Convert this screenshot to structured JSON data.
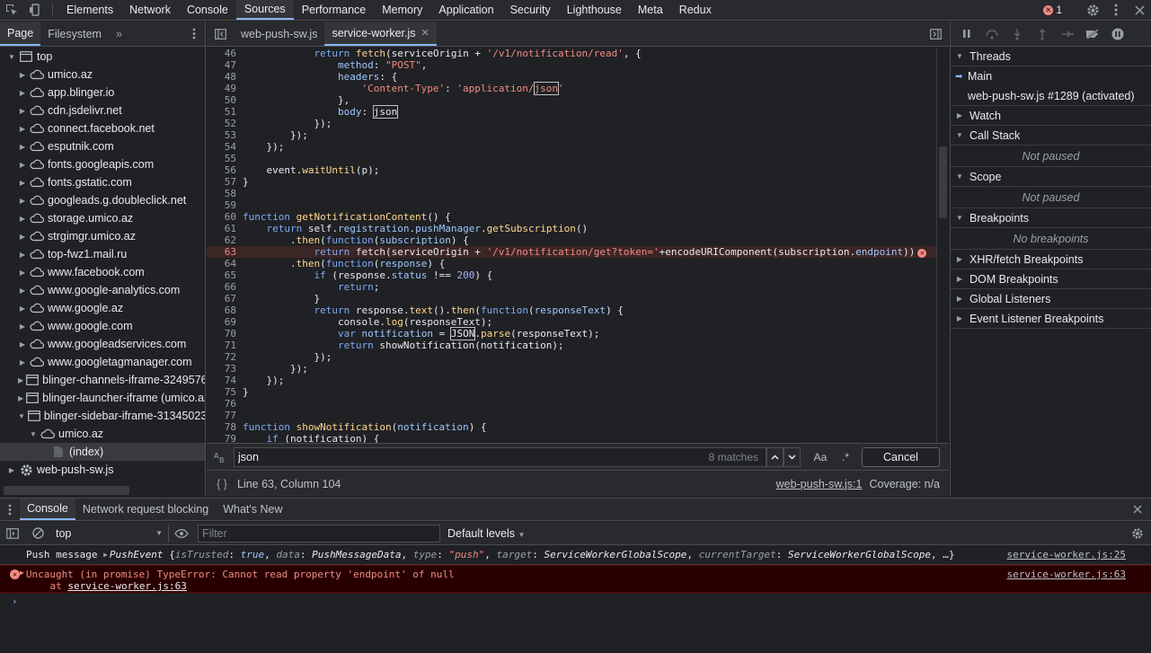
{
  "topbar": {
    "tabs": [
      "Elements",
      "Network",
      "Console",
      "Sources",
      "Performance",
      "Memory",
      "Application",
      "Security",
      "Lighthouse",
      "Meta",
      "Redux"
    ],
    "active_tab": "Sources",
    "error_count": "1"
  },
  "navigator": {
    "tabs": [
      "Page",
      "Filesystem"
    ],
    "tree": [
      {
        "label": "top",
        "icon": "frame",
        "depth": 0,
        "arrow": "down"
      },
      {
        "label": "umico.az",
        "icon": "cloud",
        "depth": 1,
        "arrow": "right"
      },
      {
        "label": "app.blinger.io",
        "icon": "cloud",
        "depth": 1,
        "arrow": "right"
      },
      {
        "label": "cdn.jsdelivr.net",
        "icon": "cloud",
        "depth": 1,
        "arrow": "right"
      },
      {
        "label": "connect.facebook.net",
        "icon": "cloud",
        "depth": 1,
        "arrow": "right"
      },
      {
        "label": "esputnik.com",
        "icon": "cloud",
        "depth": 1,
        "arrow": "right"
      },
      {
        "label": "fonts.googleapis.com",
        "icon": "cloud",
        "depth": 1,
        "arrow": "right"
      },
      {
        "label": "fonts.gstatic.com",
        "icon": "cloud",
        "depth": 1,
        "arrow": "right"
      },
      {
        "label": "googleads.g.doubleclick.net",
        "icon": "cloud",
        "depth": 1,
        "arrow": "right"
      },
      {
        "label": "storage.umico.az",
        "icon": "cloud",
        "depth": 1,
        "arrow": "right"
      },
      {
        "label": "strgimgr.umico.az",
        "icon": "cloud",
        "depth": 1,
        "arrow": "right"
      },
      {
        "label": "top-fwz1.mail.ru",
        "icon": "cloud",
        "depth": 1,
        "arrow": "right"
      },
      {
        "label": "www.facebook.com",
        "icon": "cloud",
        "depth": 1,
        "arrow": "right"
      },
      {
        "label": "www.google-analytics.com",
        "icon": "cloud",
        "depth": 1,
        "arrow": "right"
      },
      {
        "label": "www.google.az",
        "icon": "cloud",
        "depth": 1,
        "arrow": "right"
      },
      {
        "label": "www.google.com",
        "icon": "cloud",
        "depth": 1,
        "arrow": "right"
      },
      {
        "label": "www.googleadservices.com",
        "icon": "cloud",
        "depth": 1,
        "arrow": "right"
      },
      {
        "label": "www.googletagmanager.com",
        "icon": "cloud",
        "depth": 1,
        "arrow": "right"
      },
      {
        "label": "blinger-channels-iframe-3249576",
        "icon": "frame",
        "depth": 1,
        "arrow": "right"
      },
      {
        "label": "blinger-launcher-iframe (umico.az",
        "icon": "frame",
        "depth": 1,
        "arrow": "right"
      },
      {
        "label": "blinger-sidebar-iframe-31345023",
        "icon": "frame",
        "depth": 1,
        "arrow": "down"
      },
      {
        "label": "umico.az",
        "icon": "cloud",
        "depth": 2,
        "arrow": "down"
      },
      {
        "label": "(index)",
        "icon": "file",
        "depth": 3,
        "arrow": "",
        "selected": true
      },
      {
        "label": "web-push-sw.js",
        "icon": "gear",
        "depth": 0,
        "arrow": "right"
      }
    ]
  },
  "editor": {
    "tabs": [
      {
        "label": "web-push-sw.js",
        "active": false
      },
      {
        "label": "service-worker.js",
        "active": true
      }
    ],
    "lines": [
      {
        "n": "46",
        "html": "            <span class=\"kw\">return</span> <span class=\"fn\">fetch</span>(serviceOrigin + <span class=\"str\">'/v1/notification/read'</span>, {"
      },
      {
        "n": "47",
        "html": "                <span class=\"prop\">method</span>: <span class=\"str\">\"POST\"</span>,"
      },
      {
        "n": "48",
        "html": "                <span class=\"prop\">headers</span>: {"
      },
      {
        "n": "49",
        "html": "                    <span class=\"str\">'Content-Type'</span>: <span class=\"str\">'application/<span class=\"hl\">json</span>'</span>"
      },
      {
        "n": "50",
        "html": "                },"
      },
      {
        "n": "51",
        "html": "                <span class=\"prop\">body</span>: <span class=\"hl\">json</span>"
      },
      {
        "n": "52",
        "html": "            });"
      },
      {
        "n": "53",
        "html": "        });"
      },
      {
        "n": "54",
        "html": "    });"
      },
      {
        "n": "55",
        "html": ""
      },
      {
        "n": "56",
        "html": "    event.<span class=\"fn\">waitUntil</span>(p);"
      },
      {
        "n": "57",
        "html": "}"
      },
      {
        "n": "58",
        "html": ""
      },
      {
        "n": "59",
        "html": ""
      },
      {
        "n": "60",
        "html": "<span class=\"kw\">function</span> <span class=\"fn\">getNotificationContent</span>() {"
      },
      {
        "n": "61",
        "html": "    <span class=\"kw\">return</span> self.<span class=\"prop\">registration</span>.<span class=\"prop\">pushManager</span>.<span class=\"fn\">getSubscription</span>()"
      },
      {
        "n": "62",
        "html": "        .<span class=\"fn\">then</span>(<span class=\"kw\">function</span>(<span class=\"prop\">subscription</span>) {"
      },
      {
        "n": "63",
        "html": "            <span class=\"kw\">return</span> fetch(serviceOrigin + <span class=\"str\">'/v1/notification/get?token='</span>+encodeURIComponent(subscription.<span class=\"prop\">endpoint</span>))<span class=\"errmark\">✕</span>",
        "error": true
      },
      {
        "n": "64",
        "html": "        .<span class=\"fn\">then</span>(<span class=\"kw\">function</span>(<span class=\"prop\">response</span>) {"
      },
      {
        "n": "65",
        "html": "            <span class=\"kw\">if</span> (response.<span class=\"prop\">status</span> !== <span class=\"num\">200</span>) {"
      },
      {
        "n": "66",
        "html": "                <span class=\"kw\">return</span>;"
      },
      {
        "n": "67",
        "html": "            }"
      },
      {
        "n": "68",
        "html": "            <span class=\"kw\">return</span> response.<span class=\"fn\">text</span>().<span class=\"fn\">then</span>(<span class=\"kw\">function</span>(<span class=\"prop\">responseText</span>) {"
      },
      {
        "n": "69",
        "html": "                console.<span class=\"fn\">log</span>(responseText);"
      },
      {
        "n": "70",
        "html": "                <span class=\"kw\">var</span> <span class=\"prop\">notification</span> = <span class=\"hl\">JSON</span>.<span class=\"fn\">parse</span>(responseText);"
      },
      {
        "n": "71",
        "html": "                <span class=\"kw\">return</span> showNotification(notification);"
      },
      {
        "n": "72",
        "html": "            });"
      },
      {
        "n": "73",
        "html": "        });"
      },
      {
        "n": "74",
        "html": "    });"
      },
      {
        "n": "75",
        "html": "}"
      },
      {
        "n": "76",
        "html": ""
      },
      {
        "n": "77",
        "html": ""
      },
      {
        "n": "78",
        "html": "<span class=\"kw\">function</span> <span class=\"fn\">showNotification</span>(<span class=\"prop\">notification</span>) {"
      },
      {
        "n": "79",
        "html": "    <span class=\"kw\">if</span> (notification) {"
      }
    ],
    "search": {
      "value": "json",
      "count": "8 matches",
      "case_label": "Aa",
      "regex_label": ".*",
      "cancel_label": "Cancel"
    },
    "status": {
      "pretty_label": "{ }",
      "position": "Line 63, Column 104",
      "link": "web-push-sw.js:1",
      "coverage": "Coverage: n/a"
    }
  },
  "debugger": {
    "threads_label": "Threads",
    "threads": [
      {
        "label": "Main",
        "current": true
      },
      {
        "label": "web-push-sw.js #1289 (activated)",
        "current": false
      }
    ],
    "sections": [
      {
        "label": "Watch",
        "open": false,
        "empty": ""
      },
      {
        "label": "Call Stack",
        "open": true,
        "empty": "Not paused"
      },
      {
        "label": "Scope",
        "open": true,
        "empty": "Not paused"
      },
      {
        "label": "Breakpoints",
        "open": true,
        "empty": "No breakpoints"
      },
      {
        "label": "XHR/fetch Breakpoints",
        "open": false,
        "empty": ""
      },
      {
        "label": "DOM Breakpoints",
        "open": false,
        "empty": ""
      },
      {
        "label": "Global Listeners",
        "open": false,
        "empty": ""
      },
      {
        "label": "Event Listener Breakpoints",
        "open": false,
        "empty": ""
      }
    ]
  },
  "drawer": {
    "tabs": [
      "Console",
      "Network request blocking",
      "What's New"
    ],
    "active_tab": "Console"
  },
  "console": {
    "context": "top",
    "filter_placeholder": "Filter",
    "levels": "Default levels",
    "log_prefix": "Push message ",
    "log_event": "PushEvent",
    "log_body_html": "{<span class=\"it-key\">isTrusted</span>: <span class=\"it-true\">true</span>, <span class=\"it-key\">data</span>: <span class=\"it-val\">PushMessageData</span>, <span class=\"it-key\">type</span>: <span class=\"it-str\">\"push\"</span>, <span class=\"it-key\">target</span>: <span class=\"it-val\">ServiceWorkerGlobalScope</span>, <span class=\"it-key\">currentTarget</span>: <span class=\"it-val\">ServiceWorkerGlobalScope</span>, …}",
    "log_source": "service-worker.js:25",
    "error_text": "Uncaught (in promise) TypeError: Cannot read property 'endpoint' of null",
    "error_at": "    at ",
    "error_at_link": "service-worker.js:63",
    "error_source": "service-worker.js:63",
    "prompt": "›"
  }
}
